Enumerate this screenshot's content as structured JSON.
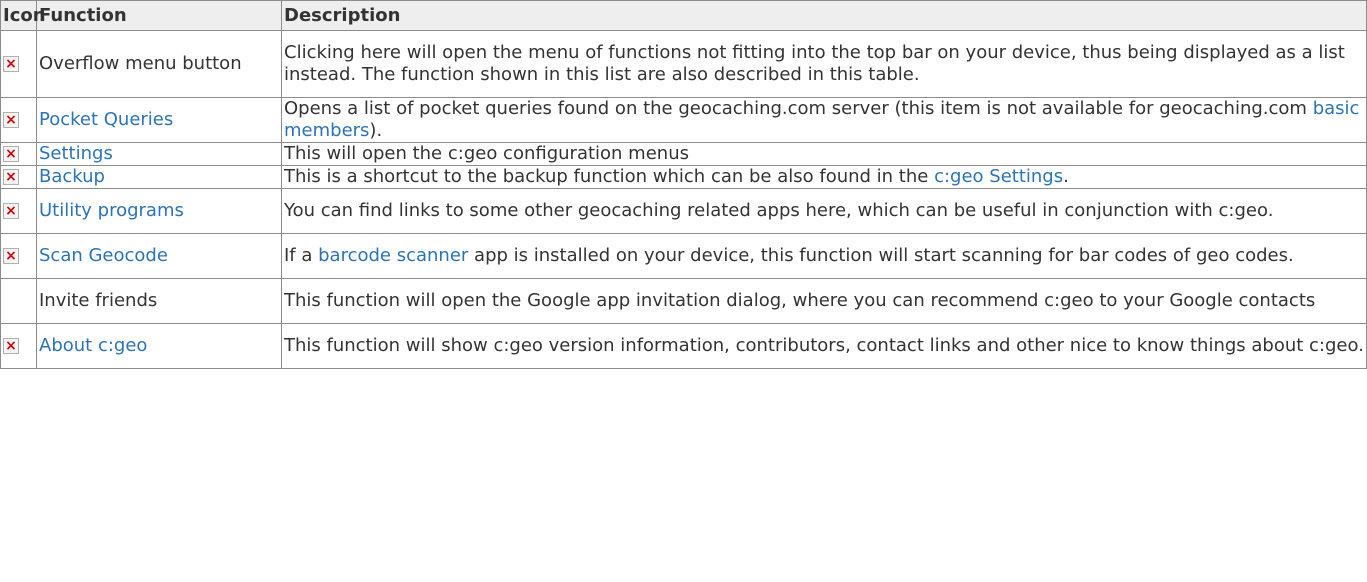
{
  "table": {
    "headers": {
      "icon": "Icon",
      "function": "Function",
      "description": "Description"
    },
    "rows": [
      {
        "icon": "broken-image-icon",
        "function": "Overflow menu button",
        "function_is_link": false,
        "description": "Clicking here will open the menu of functions not fitting into the top bar on your device, thus being displayed as a list instead. The function shown in this list are also described in this table."
      },
      {
        "icon": "broken-image-icon",
        "function": "Pocket Queries",
        "function_is_link": true,
        "description_before": "Opens a list of pocket queries found on the geocaching.com server (this item is not available for geocaching.com ",
        "description_link": "basic members",
        "description_after": ")."
      },
      {
        "icon": "broken-image-icon",
        "function": "Settings",
        "function_is_link": true,
        "description": "This will open the c:geo configuration menus"
      },
      {
        "icon": "broken-image-icon",
        "function": "Backup",
        "function_is_link": true,
        "description_before": "This is a shortcut to the backup function which can be also found in the ",
        "description_link": "c:geo Settings",
        "description_after": "."
      },
      {
        "icon": "broken-image-icon",
        "function": "Utility programs",
        "function_is_link": true,
        "description": "You can find links to some other geocaching related apps here, which can be useful in conjunction with c:geo."
      },
      {
        "icon": "broken-image-icon",
        "function": "Scan Geocode",
        "function_is_link": true,
        "description_before": "If a ",
        "description_link": "barcode scanner",
        "description_after": " app is installed on your device, this function will start scanning for bar codes of geo codes."
      },
      {
        "icon": "",
        "function": "Invite friends",
        "function_is_link": false,
        "description": "This function will open the Google app invitation dialog, where you can recommend c:geo to your Google contacts"
      },
      {
        "icon": "broken-image-icon",
        "function": "About c:geo",
        "function_is_link": true,
        "description": "This function will show c:geo version information, contributors, contact links and other nice to know things about c:geo."
      }
    ]
  },
  "colors": {
    "link": "#2b73b7",
    "text": "#333333",
    "header_bg": "#eeeeee",
    "border": "#8c8c8c",
    "icon_x": "#cc0000"
  }
}
